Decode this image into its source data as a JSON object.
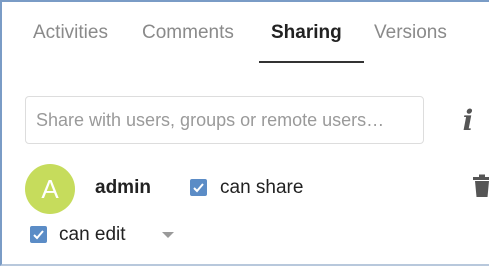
{
  "tabs": [
    {
      "label": "Activities"
    },
    {
      "label": "Comments"
    },
    {
      "label": "Sharing"
    },
    {
      "label": "Versions"
    }
  ],
  "active_tab": "Sharing",
  "search": {
    "placeholder": "Share with users, groups or remote users…",
    "value": ""
  },
  "info_icon": "info-icon",
  "share": {
    "avatar_letter": "A",
    "avatar_color": "#c6dc5c",
    "username": "admin",
    "can_share_label": "can share",
    "can_share_checked": true,
    "can_edit_label": "can edit",
    "can_edit_checked": true,
    "delete_icon": "trash-icon",
    "expand_icon": "caret-down-icon"
  },
  "colors": {
    "accent": "#5b8cc6",
    "border": "#7a9cc6"
  }
}
